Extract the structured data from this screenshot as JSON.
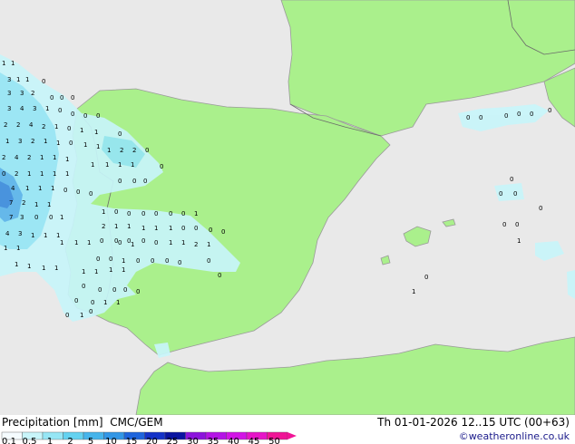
{
  "header": {
    "title": "Precipitation [mm]",
    "model": "CMC/GEM",
    "valid_time": "Th 01-01-2026 12..15 UTC (00+63)",
    "credit": "©weatheronline.co.uk"
  },
  "colors": {
    "sea": "#e9e9e9",
    "land": "#aaf08c",
    "coast": "#9a9a9a",
    "border": "#6a6a6a",
    "precip_light": "#c8f5fa",
    "precip_mod": "#96e6f5",
    "precip_heavy": "#5ab4eb",
    "precip_core": "#3c8cdc"
  },
  "legend": {
    "ticks": [
      "0.1",
      "0.5",
      "1",
      "2",
      "5",
      "10",
      "15",
      "20",
      "25",
      "30",
      "35",
      "40",
      "45",
      "50"
    ],
    "swatches": [
      "#f5fcff",
      "#c8f5fa",
      "#96e6f5",
      "#64d2f0",
      "#46b4eb",
      "#3296e6",
      "#1e64dc",
      "#1432c8",
      "#0a14a0",
      "#8c14dc",
      "#b414e6",
      "#d214e6",
      "#e614c8",
      "#f01496"
    ]
  },
  "map": {
    "labels": [
      {
        "t": "1"
      },
      {
        "t": "1"
      },
      {
        "t": "3"
      },
      {
        "t": "1"
      },
      {
        "t": "1"
      },
      {
        "t": "0"
      },
      {
        "t": "3"
      },
      {
        "t": "3"
      },
      {
        "t": "2"
      },
      {
        "t": "0"
      },
      {
        "t": "0"
      },
      {
        "t": "0"
      },
      {
        "t": "3"
      },
      {
        "t": "4"
      },
      {
        "t": "3"
      },
      {
        "t": "1"
      },
      {
        "t": "0"
      },
      {
        "t": "0"
      },
      {
        "t": "0"
      },
      {
        "t": "0"
      },
      {
        "t": "2"
      },
      {
        "t": "2"
      },
      {
        "t": "4"
      },
      {
        "t": "2"
      },
      {
        "t": "1"
      },
      {
        "t": "0"
      },
      {
        "t": "1"
      },
      {
        "t": "1"
      },
      {
        "t": "1"
      },
      {
        "t": "3"
      },
      {
        "t": "2"
      },
      {
        "t": "1"
      },
      {
        "t": "1"
      },
      {
        "t": "0"
      },
      {
        "t": "1"
      },
      {
        "t": "1"
      },
      {
        "t": "0"
      },
      {
        "t": "2"
      },
      {
        "t": "4"
      },
      {
        "t": "2"
      },
      {
        "t": "1"
      },
      {
        "t": "1"
      },
      {
        "t": "1"
      },
      {
        "t": "1"
      },
      {
        "t": "2"
      },
      {
        "t": "2"
      },
      {
        "t": "0"
      },
      {
        "t": "0"
      },
      {
        "t": "2"
      },
      {
        "t": "1"
      },
      {
        "t": "1"
      },
      {
        "t": "1"
      },
      {
        "t": "1"
      },
      {
        "t": "1"
      },
      {
        "t": "1"
      },
      {
        "t": "1"
      },
      {
        "t": "1"
      },
      {
        "t": "0"
      },
      {
        "t": "4"
      },
      {
        "t": "1"
      },
      {
        "t": "1"
      },
      {
        "t": "1"
      },
      {
        "t": "0"
      },
      {
        "t": "0"
      },
      {
        "t": "0"
      },
      {
        "t": "7"
      },
      {
        "t": "2"
      },
      {
        "t": "1"
      },
      {
        "t": "1"
      },
      {
        "t": "0"
      },
      {
        "t": "0"
      },
      {
        "t": "0"
      },
      {
        "t": "7"
      },
      {
        "t": "3"
      },
      {
        "t": "0"
      },
      {
        "t": "0"
      },
      {
        "t": "1"
      },
      {
        "t": "4"
      },
      {
        "t": "3"
      },
      {
        "t": "1"
      },
      {
        "t": "1"
      },
      {
        "t": "1"
      },
      {
        "t": "1"
      },
      {
        "t": "0"
      },
      {
        "t": "0"
      },
      {
        "t": "0"
      },
      {
        "t": "0"
      },
      {
        "t": "0"
      },
      {
        "t": "0"
      },
      {
        "t": "1"
      },
      {
        "t": "1"
      },
      {
        "t": "1"
      },
      {
        "t": "1"
      },
      {
        "t": "1"
      },
      {
        "t": "1"
      },
      {
        "t": "0"
      },
      {
        "t": "0"
      },
      {
        "t": "0"
      },
      {
        "t": "0"
      },
      {
        "t": "0"
      },
      {
        "t": "1"
      },
      {
        "t": "1"
      },
      {
        "t": "2"
      },
      {
        "t": "2"
      },
      {
        "t": "1"
      },
      {
        "t": "1"
      },
      {
        "t": "1"
      },
      {
        "t": "1"
      },
      {
        "t": "1"
      },
      {
        "t": "0"
      },
      {
        "t": "0"
      },
      {
        "t": "0"
      },
      {
        "t": "0"
      },
      {
        "t": "0"
      },
      {
        "t": "1"
      },
      {
        "t": "1"
      },
      {
        "t": "1"
      },
      {
        "t": "1"
      },
      {
        "t": "1"
      },
      {
        "t": "1"
      },
      {
        "t": "0"
      },
      {
        "t": "0"
      },
      {
        "t": "1"
      },
      {
        "t": "1"
      },
      {
        "t": "1"
      },
      {
        "t": "1"
      },
      {
        "t": "1"
      },
      {
        "t": "0"
      },
      {
        "t": "0"
      },
      {
        "t": "0"
      },
      {
        "t": "0"
      },
      {
        "t": "0"
      },
      {
        "t": "0"
      },
      {
        "t": "0"
      },
      {
        "t": "0"
      },
      {
        "t": "0"
      },
      {
        "t": "0"
      },
      {
        "t": "0"
      },
      {
        "t": "1"
      },
      {
        "t": "1"
      },
      {
        "t": "0"
      },
      {
        "t": "1"
      },
      {
        "t": "0"
      },
      {
        "t": "0"
      },
      {
        "t": "0"
      },
      {
        "t": "0"
      },
      {
        "t": "0"
      },
      {
        "t": "0"
      },
      {
        "t": "0"
      },
      {
        "t": "0"
      },
      {
        "t": "0"
      },
      {
        "t": "0"
      },
      {
        "t": "0"
      },
      {
        "t": "0"
      },
      {
        "t": "0"
      },
      {
        "t": "0"
      },
      {
        "t": "0"
      },
      {
        "t": "1"
      },
      {
        "t": "0"
      },
      {
        "t": "1"
      }
    ]
  }
}
